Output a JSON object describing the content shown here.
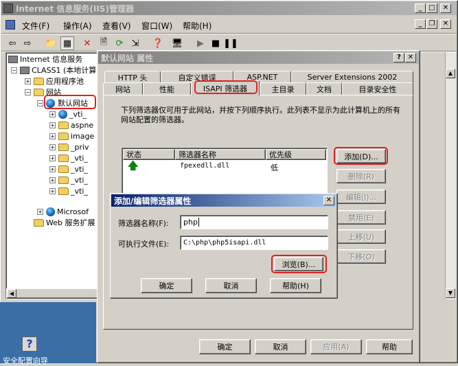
{
  "main_window": {
    "title": "Internet 信息服务(IIS)管理器",
    "menu": [
      "文件(F)",
      "操作(A)",
      "查看(V)",
      "窗口(W)",
      "帮助(H)"
    ],
    "tree": {
      "root": "Internet 信息服务",
      "computer": "CLASS1 (本地计算",
      "app_pools": "应用程序池",
      "websites": "网站",
      "default_site": "默认网站",
      "children": [
        "_vti_",
        "aspne",
        "image",
        "_priv",
        "_vti_",
        "_vti_",
        "_vti_",
        "_vti_"
      ],
      "microsoft": "Microsof",
      "web_ext": "Web 服务扩展"
    },
    "desktop_icon_label": "安全配置向导"
  },
  "properties_dialog": {
    "title": "默认网站 属性",
    "tabs_back": [
      "HTTP 头",
      "自定义错误",
      "ASP.NET",
      "Server Extensions 2002"
    ],
    "tabs_front": [
      "网站",
      "性能",
      "ISAPI 筛选器",
      "主目录",
      "文档",
      "目录安全性"
    ],
    "description": "下列筛选器仅可用于此网站，并按下列顺序执行。此列表不显示为此计算机上的所有网站配置的筛选器。",
    "columns": [
      "状态",
      "筛选器名称",
      "优先级"
    ],
    "rows": [
      {
        "name": "fpexedll.dll",
        "priority": "低"
      }
    ],
    "side_buttons": {
      "add": "添加(D)...",
      "remove": "删除(R)",
      "edit": "编辑(I)...",
      "disable": "禁用(E)",
      "up": "上移(U)",
      "down": "下移(O)"
    },
    "footer_buttons": {
      "ok": "确定",
      "cancel": "取消",
      "apply": "应用(A)",
      "help": "帮助"
    }
  },
  "filter_dialog": {
    "title": "添加/编辑筛选器属性",
    "name_label": "筛选器名称(F):",
    "name_value": "php",
    "exe_label": "可执行文件(E):",
    "exe_value": "C:\\php\\php5isapi.dll",
    "browse": "浏览(B)...",
    "ok": "确定",
    "cancel": "取消",
    "help": "帮助(H)"
  },
  "colors": {
    "titlebar_active": "#0a246a",
    "titlebar_inactive": "#808080",
    "highlight_ring": "#e02020"
  }
}
